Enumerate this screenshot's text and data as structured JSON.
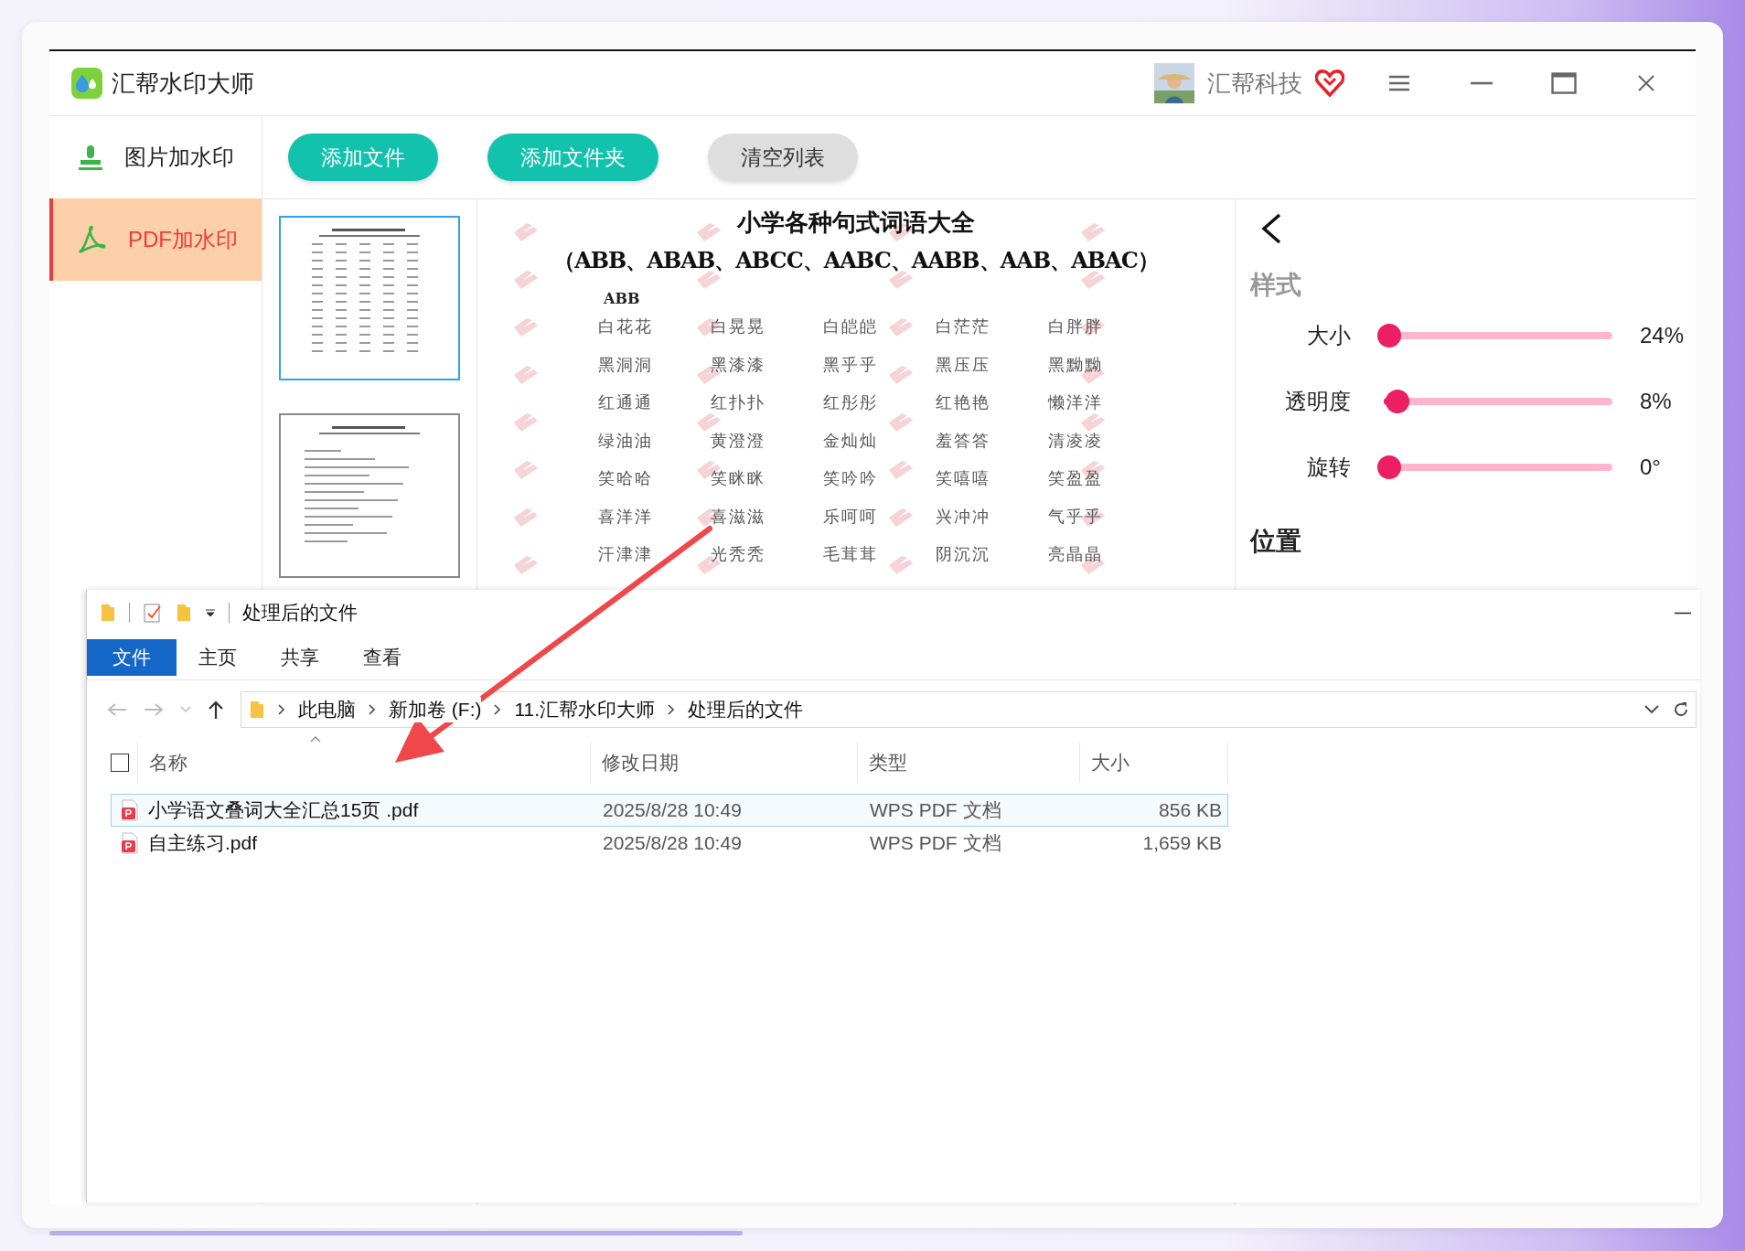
{
  "app": {
    "title": "汇帮水印大师",
    "user": "汇帮科技"
  },
  "sidebar": [
    {
      "label": "图片加水印",
      "kind": "image",
      "selected": false
    },
    {
      "label": "PDF加水印",
      "kind": "pdf",
      "selected": true
    }
  ],
  "toolbar": [
    {
      "label": "添加文件",
      "kind": "primary"
    },
    {
      "label": "添加文件夹",
      "kind": "primary"
    },
    {
      "label": "清空列表",
      "kind": "secondary"
    }
  ],
  "thumbnails": [
    {
      "selected": true
    },
    {
      "selected": false
    }
  ],
  "preview": {
    "title": "小学各种句式词语大全",
    "subtitle": "（ABB、ABAB、ABCC、AABC、AABB、AAB、ABAC）",
    "section": "ABB",
    "rows": [
      [
        "白花花",
        "白晃晃",
        "白皑皑",
        "白茫茫",
        "白胖胖"
      ],
      [
        "黑洞洞",
        "黑漆漆",
        "黑乎乎",
        "黑压压",
        "黑黝黝"
      ],
      [
        "红通通",
        "红扑扑",
        "红彤彤",
        "红艳艳",
        "懒洋洋"
      ],
      [
        "绿油油",
        "黄澄澄",
        "金灿灿",
        "羞答答",
        "清凌凌"
      ],
      [
        "笑哈哈",
        "笑眯眯",
        "笑吟吟",
        "笑嘻嘻",
        "笑盈盈"
      ],
      [
        "喜洋洋",
        "喜滋滋",
        "乐呵呵",
        "兴冲冲",
        "气乎乎"
      ],
      [
        "汗津津",
        "光秃秃",
        "毛茸茸",
        "阴沉沉",
        "亮晶晶"
      ]
    ]
  },
  "style_panel": {
    "heading": "样式",
    "sliders": [
      {
        "label": "大小",
        "level": 0.0,
        "reading": "24%"
      },
      {
        "label": "透明度",
        "level": 0.04,
        "reading": "8%"
      },
      {
        "label": "旋转",
        "level": 0.0,
        "reading": "0°"
      }
    ],
    "position_heading": "位置"
  },
  "explorer": {
    "title": "处理后的文件",
    "ribbon_tabs": [
      {
        "label": "文件",
        "selected": true
      },
      {
        "label": "主页",
        "selected": false
      },
      {
        "label": "共享",
        "selected": false
      },
      {
        "label": "查看",
        "selected": false
      }
    ],
    "breadcrumbs": [
      "此电脑",
      "新加卷 (F:)",
      "11.汇帮水印大师",
      "处理后的文件"
    ],
    "select_all": {
      "checked": false
    },
    "columns": [
      "名称",
      "修改日期",
      "类型",
      "大小"
    ],
    "files": [
      {
        "name": "小学语文叠词大全汇总15页 .pdf",
        "modified": "2025/8/28 10:49",
        "type": "WPS PDF 文档",
        "size": "856 KB",
        "selected": true
      },
      {
        "name": "自主练习.pdf",
        "modified": "2025/8/28 10:49",
        "type": "WPS PDF 文档",
        "size": "1,659 KB",
        "selected": false
      }
    ]
  }
}
